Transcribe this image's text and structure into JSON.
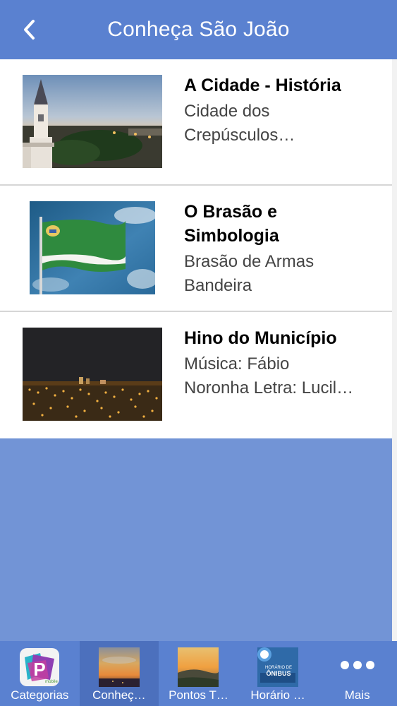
{
  "header": {
    "title": "Conheça São João",
    "back_icon": "chevron-left-icon"
  },
  "items": [
    {
      "title": "A Cidade - História",
      "subtitle_line1": "Cidade dos",
      "subtitle_line2": "Crepúsculos…",
      "image": "city-church-photo"
    },
    {
      "title_line1": "O Brasão e",
      "title_line2": "Simbologia",
      "subtitle_line1": "Brasão de Armas",
      "subtitle_line2": "Bandeira",
      "image": "flag-photo"
    },
    {
      "title": "Hino do Município",
      "subtitle_line1": "Música: Fábio",
      "subtitle_line2": "Noronha Letra: Lucil…",
      "image": "city-night-photo"
    }
  ],
  "tabs": [
    {
      "label": "Categorias",
      "icon": "categorias-app-icon",
      "active": false
    },
    {
      "label": "Conheç…",
      "icon": "sunset-thumbnail-icon",
      "active": true
    },
    {
      "label": "Pontos T…",
      "icon": "landscape-thumbnail-icon",
      "active": false
    },
    {
      "label": "Horário …",
      "icon": "bus-schedule-icon",
      "icon_text_1": "HORÁRIO DE",
      "icon_text_2": "ÔNIBUS",
      "active": false
    },
    {
      "label": "Mais",
      "icon": "more-dots-icon",
      "active": false
    }
  ],
  "colors": {
    "header": "#5a81d0",
    "background": "#7294d6",
    "tabbar": "#5a81d0",
    "active_tab": "#4c70bd"
  }
}
